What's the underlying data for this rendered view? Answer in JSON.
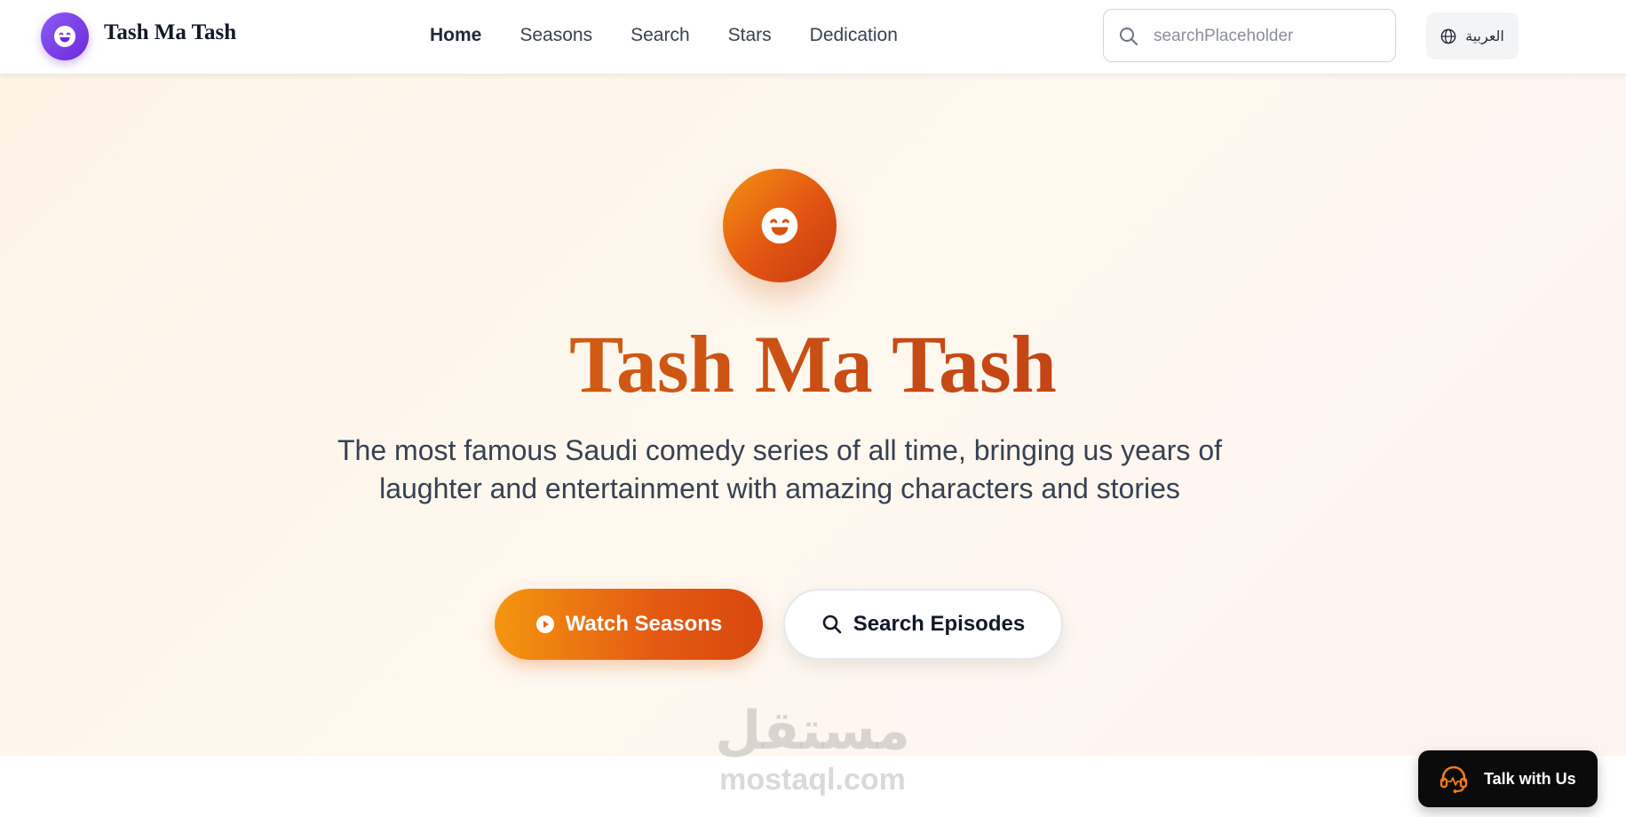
{
  "header": {
    "brand": "Tash Ma Tash",
    "nav": [
      {
        "label": "Home",
        "active": true
      },
      {
        "label": "Seasons",
        "active": false
      },
      {
        "label": "Search",
        "active": false
      },
      {
        "label": "Stars",
        "active": false
      },
      {
        "label": "Dedication",
        "active": false
      }
    ],
    "search_placeholder": "searchPlaceholder",
    "language_label": "العربية"
  },
  "hero": {
    "title": "Tash Ma Tash",
    "subtitle": "The most famous Saudi comedy series of all time, bringing us years of laughter and entertainment with amazing characters and stories",
    "primary_button": "Watch Seasons",
    "secondary_button": "Search Episodes"
  },
  "watermark": {
    "arabic": "مستقل",
    "latin": "mostaql.com"
  },
  "chat": {
    "label": "Talk with Us"
  },
  "colors": {
    "brand_purple": "#7c3aed",
    "accent_orange": "#e45a12",
    "title_gradient_start": "#e07b10",
    "title_gradient_end": "#b2301a",
    "hero_bg": "#fdf4e6"
  },
  "icons": {
    "logo": "laughing-face-icon",
    "search": "search-icon",
    "language": "globe-icon",
    "play": "play-circle-icon",
    "chat": "headset-icon"
  }
}
